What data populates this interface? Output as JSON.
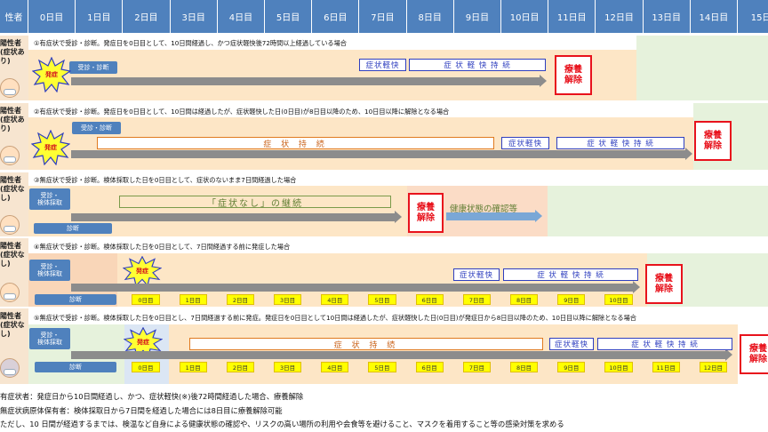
{
  "header": {
    "corner": "性者",
    "days": [
      "0日目",
      "1日目",
      "2日目",
      "3日目",
      "4日目",
      "5日目",
      "6日目",
      "7日目",
      "8日目",
      "9日目",
      "10日目",
      "11日目",
      "12日目",
      "13日目",
      "14日目",
      "15日"
    ]
  },
  "colors": {
    "header_blue": "#4f81bd",
    "release_red": "#e8121c",
    "onset_red": "#d4101c",
    "day_yellow": "#ffff00"
  },
  "labels": {
    "consult": "受診・診断",
    "consult_test": "受診・\n検体採取",
    "diagnosis": "診断",
    "onset": "発症",
    "symptom_relief": "症状軽快",
    "relief_continue": "症 状 軽 快 持 続",
    "symptom_continue": "症 状 持 続",
    "release": "療養\n解除",
    "no_symptom": "「症状なし」の継続",
    "health_check": "健康状態の確認等"
  },
  "lanes": [
    {
      "label": "陽性者\n(症状あ\nり)",
      "description": "①有症状で受診・診断。発症日を0日目として、10日間経過し、かつ症状軽快後72時間以上経過している場合"
    },
    {
      "label": "陽性者\n(症状あ\nり)",
      "description": "②有症状で受診・診断。発症日を0日目として、10日間は経過したが、症状軽快した日(0日目)が8日目以降のため、10日目以降に解除となる場合"
    },
    {
      "label": "陽性者\n(症状な\nし)",
      "description": "③無症状で受診・診断。検体採取した日を0日目として、症状のないまま7日間経過した場合"
    },
    {
      "label": "陽性者\n(症状な\nし)",
      "description": "④無症状で受診・診断。検体採取した日を0日目として、7日間経過する前に発症した場合",
      "day_cells": [
        "0日目",
        "1日目",
        "2日目",
        "3日目",
        "4日目",
        "5日目",
        "6日目",
        "7日目",
        "8日目",
        "9日目",
        "10日目"
      ]
    },
    {
      "label": "陽性者\n(症状な\nし)",
      "description": "⑤無症状で受診・診断。検体採取した日を0日目とし、7日間経過する前に発症。発症日を0日目として10日間は経過したが、症状軽快した日(0日目)が発症日から8日目以降のため、10日目以降に解除となる場合",
      "day_cells": [
        "0日目",
        "1日目",
        "2日目",
        "3日目",
        "4日目",
        "5日目",
        "6日目",
        "7日目",
        "8日目",
        "9日目",
        "10日目",
        "11日目",
        "12日目"
      ]
    }
  ],
  "footer": [
    "有症状者：発症日から10日間経過し、かつ、症状軽快(※)後72時間経過した場合、療養解除",
    "無症状病原体保有者：検体採取日から7日間を経過した場合には8日目に療養解除可能",
    "ただし、10 日間が経過するまでは、検温など自身による健康状態の確認や、リスクの高い場所の利用や会食等を避けること、マスクを着用すること等の感染対策を求める"
  ]
}
